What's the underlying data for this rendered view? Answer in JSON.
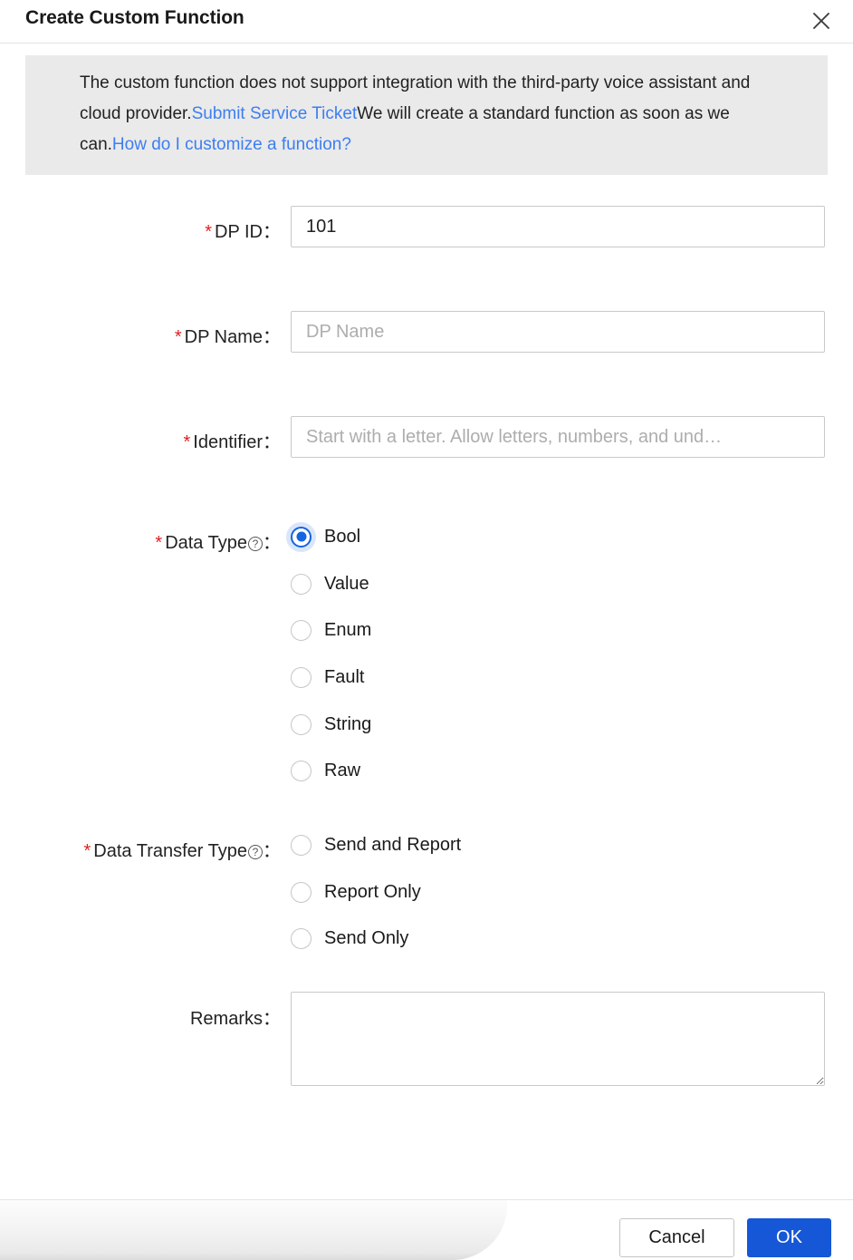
{
  "dialog": {
    "title": "Create Custom Function",
    "close_icon": "close-icon"
  },
  "notice": {
    "text_part1": "The custom function does not support integration with the third-party voice assistant and cloud provider.",
    "link1": "Submit Service Ticket",
    "text_part2": "We will create a standard function as soon as we can.",
    "link2": "How do I customize a function?",
    "background_color": "#eaeaea",
    "link_color": "#3c7ef0"
  },
  "form": {
    "dp_id": {
      "label": "DP ID",
      "required_mark": "*",
      "colon": "：",
      "value": "101",
      "placeholder": ""
    },
    "dp_name": {
      "label": "DP Name",
      "required_mark": "*",
      "colon": "：",
      "value": "",
      "placeholder": "DP Name"
    },
    "identifier": {
      "label": "Identifier",
      "required_mark": "*",
      "colon": "：",
      "value": "",
      "placeholder": "Start with a letter. Allow letters, numbers, and und…"
    },
    "data_type": {
      "label": "Data Type",
      "required_mark": "*",
      "colon": "：",
      "help_icon": "question-mark-icon",
      "selected": "Bool",
      "options": [
        {
          "label": "Bool",
          "checked": true
        },
        {
          "label": "Value",
          "checked": false
        },
        {
          "label": "Enum",
          "checked": false
        },
        {
          "label": "Fault",
          "checked": false
        },
        {
          "label": "String",
          "checked": false
        },
        {
          "label": "Raw",
          "checked": false
        }
      ]
    },
    "data_transfer_type": {
      "label": "Data Transfer Type",
      "required_mark": "*",
      "colon": "：",
      "help_icon": "question-mark-icon",
      "selected": "",
      "options": [
        {
          "label": "Send and Report",
          "checked": false
        },
        {
          "label": "Report Only",
          "checked": false
        },
        {
          "label": "Send Only",
          "checked": false
        }
      ]
    },
    "remarks": {
      "label": "Remarks",
      "required_mark": "",
      "colon": "：",
      "value": "",
      "placeholder": ""
    }
  },
  "footer": {
    "cancel_label": "Cancel",
    "ok_label": "OK",
    "ok_color": "#1557d6"
  }
}
